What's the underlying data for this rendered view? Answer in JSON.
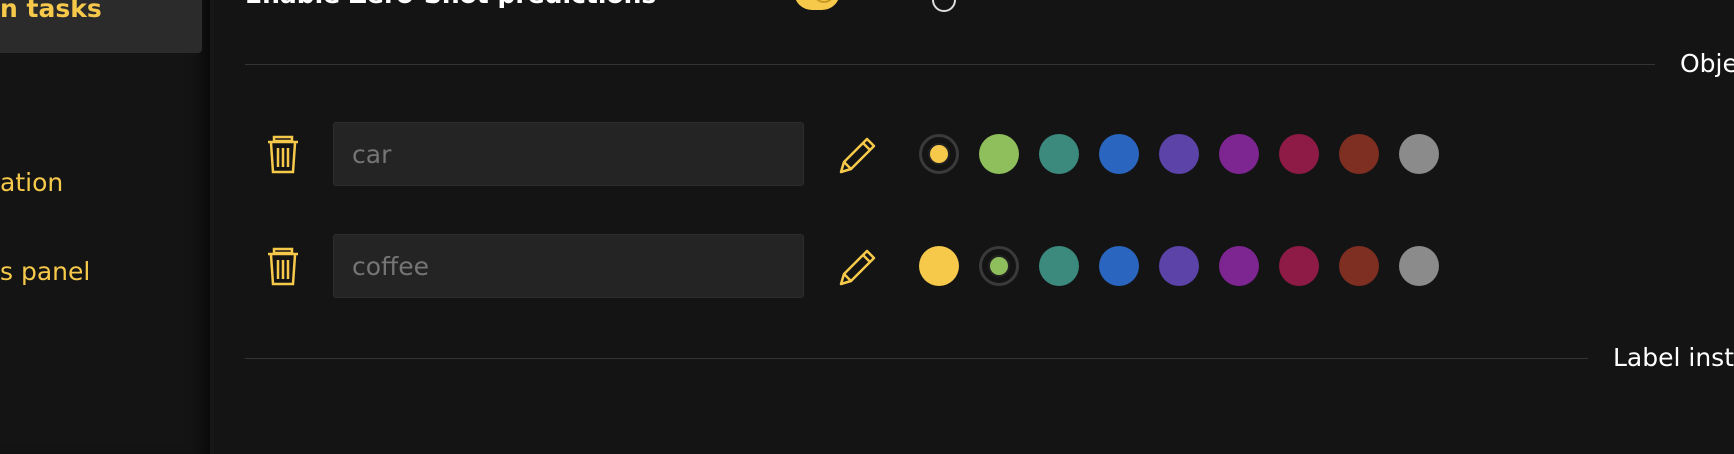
{
  "sidebar": {
    "items": [
      {
        "label": "n tasks",
        "active": true
      },
      {
        "label": "ation",
        "active": false
      },
      {
        "label": "s panel",
        "active": false
      }
    ]
  },
  "topbar": {
    "zero_shot_label": "Enable Zero-Shot predictions",
    "zero_shot_enabled": true
  },
  "sections": {
    "objects_title": "Obje",
    "label_inst_title": "Label inst"
  },
  "palette": [
    "#f6c94b",
    "#8fbe5c",
    "#3c8a7e",
    "#2a65bf",
    "#5b43a8",
    "#7d2590",
    "#8e1b45",
    "#7e2f22",
    "#8b8b8b"
  ],
  "accent": "#f6c94b",
  "labels": [
    {
      "value": "",
      "placeholder": "car",
      "selected_color": 0
    },
    {
      "value": "",
      "placeholder": "coffee",
      "selected_color": 1
    }
  ]
}
